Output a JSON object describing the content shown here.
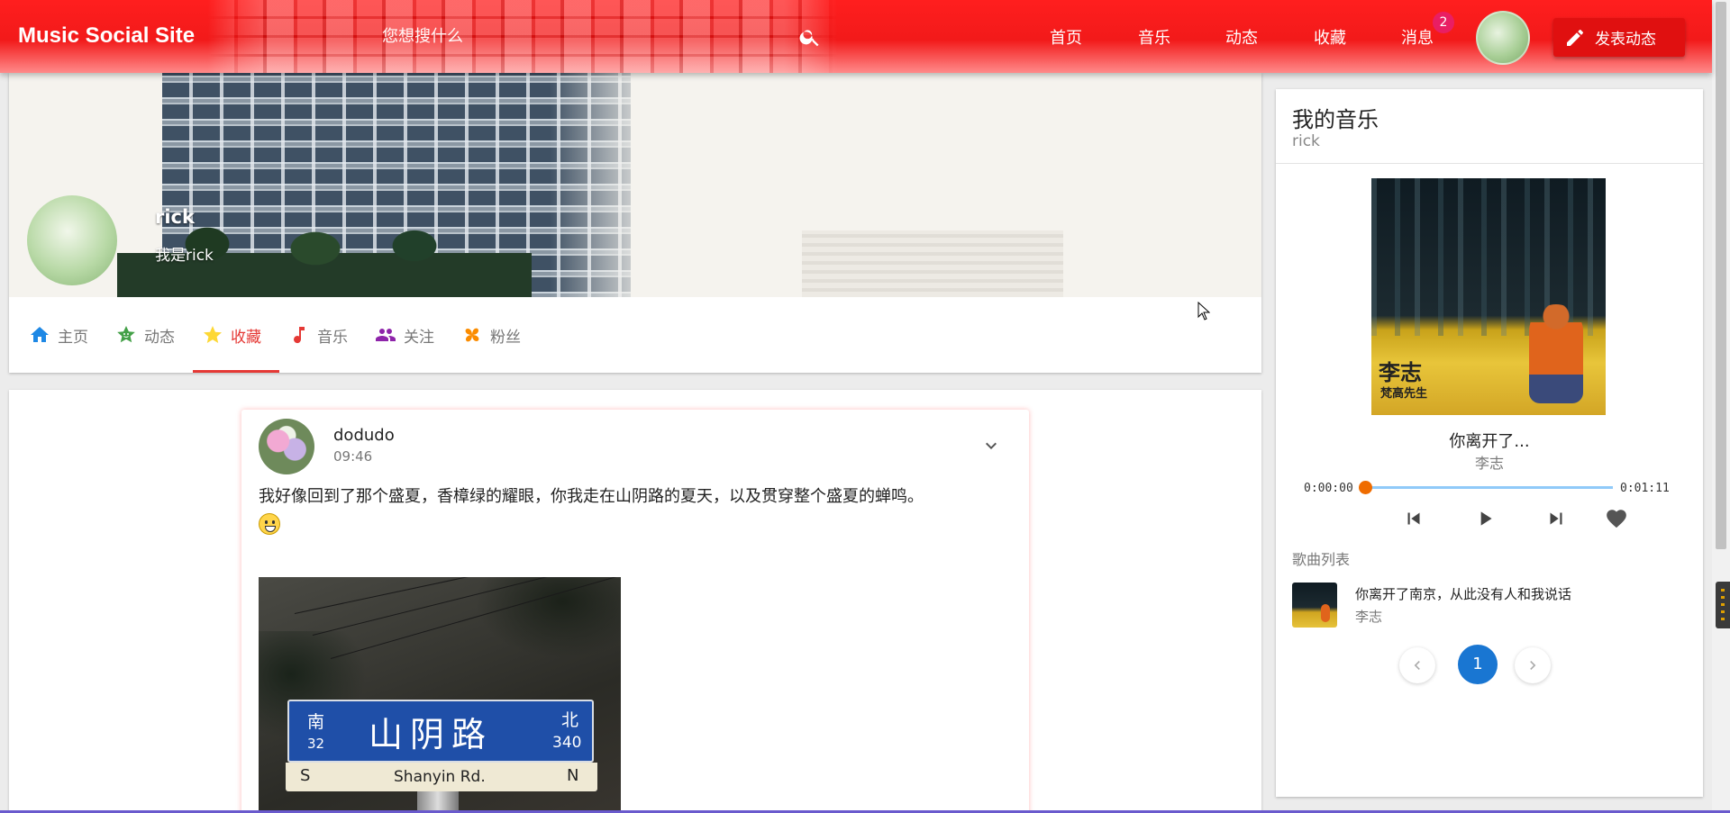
{
  "header": {
    "brand": "Music Social Site",
    "search_placeholder": "您想搜什么",
    "nav": [
      "首页",
      "音乐",
      "动态",
      "收藏",
      "消息"
    ],
    "message_badge": "2",
    "post_button": "发表动态"
  },
  "profile": {
    "name": "rick",
    "bio": "我是rick",
    "tabs": [
      {
        "label": "主页",
        "icon": "home-icon"
      },
      {
        "label": "动态",
        "icon": "smiley-star-icon"
      },
      {
        "label": "收藏",
        "icon": "star-icon"
      },
      {
        "label": "音乐",
        "icon": "music-note-icon"
      },
      {
        "label": "关注",
        "icon": "people-icon"
      },
      {
        "label": "粉丝",
        "icon": "pinwheel-icon"
      }
    ],
    "active_tab": "收藏"
  },
  "post": {
    "user": "dodudo",
    "time": "09:46",
    "text": "我好像回到了那个盛夏，香樟绿的耀眼，你我走在山阴路的夏天，以及贯穿整个盛夏的蝉鸣。",
    "photo": {
      "sign_cn": "山阴路",
      "left_dir": "南",
      "left_num": "32",
      "right_dir": "北",
      "right_num": "340",
      "bottom_left": "S",
      "bottom_en": "Shanyin Rd.",
      "bottom_right": "N"
    }
  },
  "music": {
    "title": "我的音乐",
    "owner": "rick",
    "cover_artist": "李志",
    "cover_album": "梵高先生",
    "now_playing_title": "你离开了...",
    "now_playing_artist": "李志",
    "current_time": "0:00:00",
    "duration": "0:01:11",
    "progress": 0,
    "playlist_label": "歌曲列表",
    "playlist": [
      {
        "title": "你离开了南京，从此没有人和我说话",
        "artist": "李志"
      }
    ],
    "page": "1"
  },
  "colors": {
    "header_red": "#f21a1a",
    "accent_red": "#e53935",
    "pagination_blue": "#1976d2",
    "progress_orange": "#ef6c00",
    "badge_pink": "#e91e63"
  }
}
